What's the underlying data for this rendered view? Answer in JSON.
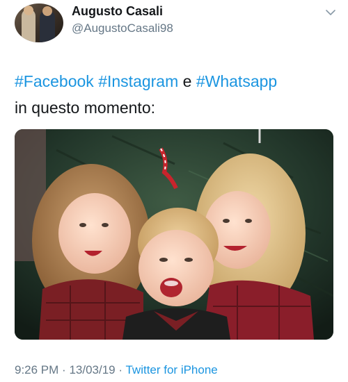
{
  "author": {
    "name": "Augusto Casali",
    "handle": "@AugustoCasali98"
  },
  "tweet": {
    "hashtags": [
      "#Facebook",
      "#Instagram",
      "#Whatsapp"
    ],
    "connector": "e",
    "line2": "in questo momento:"
  },
  "media": {
    "icon": "photo-children-christmas"
  },
  "footer": {
    "time": "9:26 PM",
    "date": "13/03/19",
    "separator": "·",
    "source": "Twitter for iPhone"
  },
  "colors": {
    "link": "#1b95e0",
    "secondary": "#657786",
    "text": "#14171a"
  }
}
